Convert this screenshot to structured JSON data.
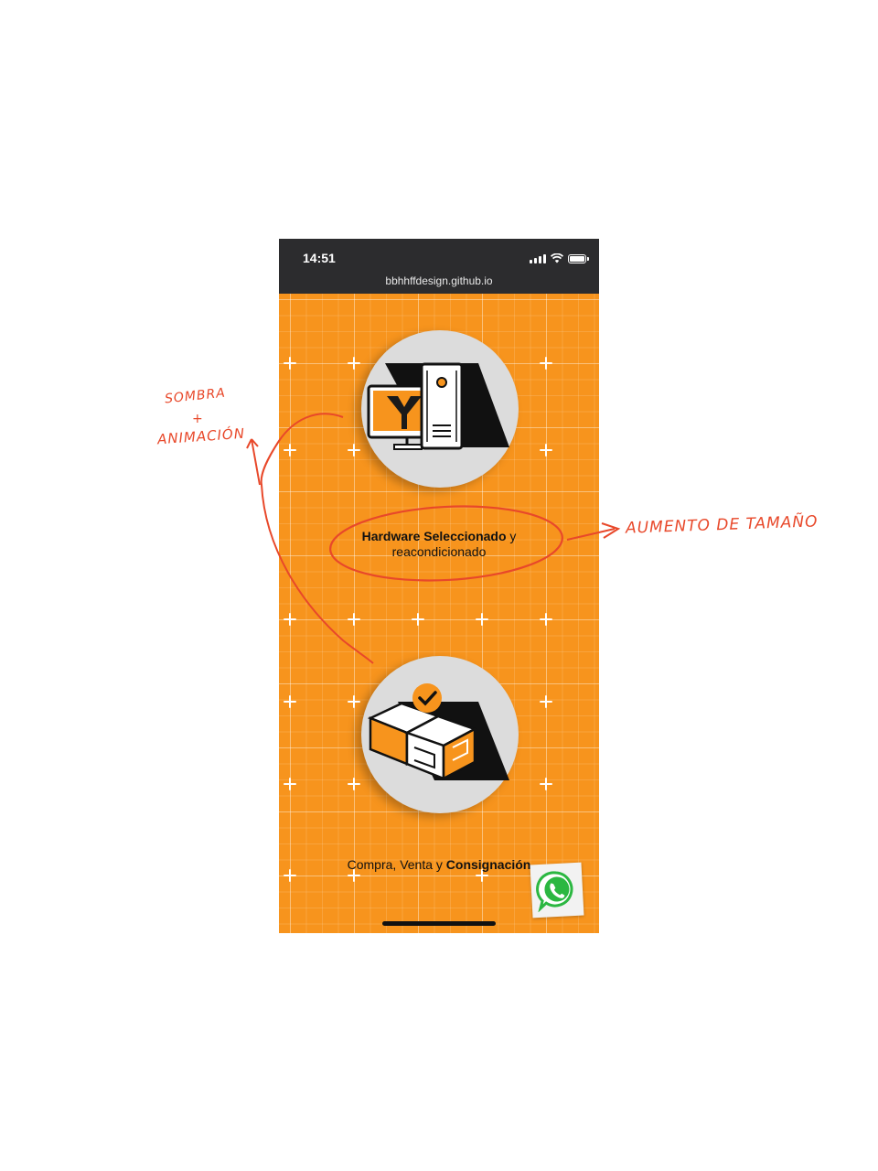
{
  "status_bar": {
    "time": "14:51",
    "url": "bbhhffdesign.github.io",
    "icons": [
      "signal-icon",
      "wifi-icon",
      "battery-icon"
    ]
  },
  "cards": [
    {
      "icon": "computer-hardware-icon",
      "caption_bold": "Hardware Seleccionado",
      "caption_rest": " y",
      "caption_line2": "reacondicionado"
    },
    {
      "icon": "boxes-check-icon",
      "caption_prefix": "Compra, Venta y ",
      "caption_bold": "Consignación"
    }
  ],
  "whatsapp": {
    "icon": "whatsapp-icon"
  },
  "annotations": {
    "note1_line1": "SOMBRA",
    "note1_line2": "+",
    "note1_line3": "ANIMACIÓN",
    "note2": "AUMENTO DE TAMAÑO"
  },
  "colors": {
    "background": "#f7941d",
    "status_bar": "#2c2c2e",
    "circle": "#dcdcdc",
    "annotation": "#e8482a",
    "whatsapp": "#2bb741"
  }
}
